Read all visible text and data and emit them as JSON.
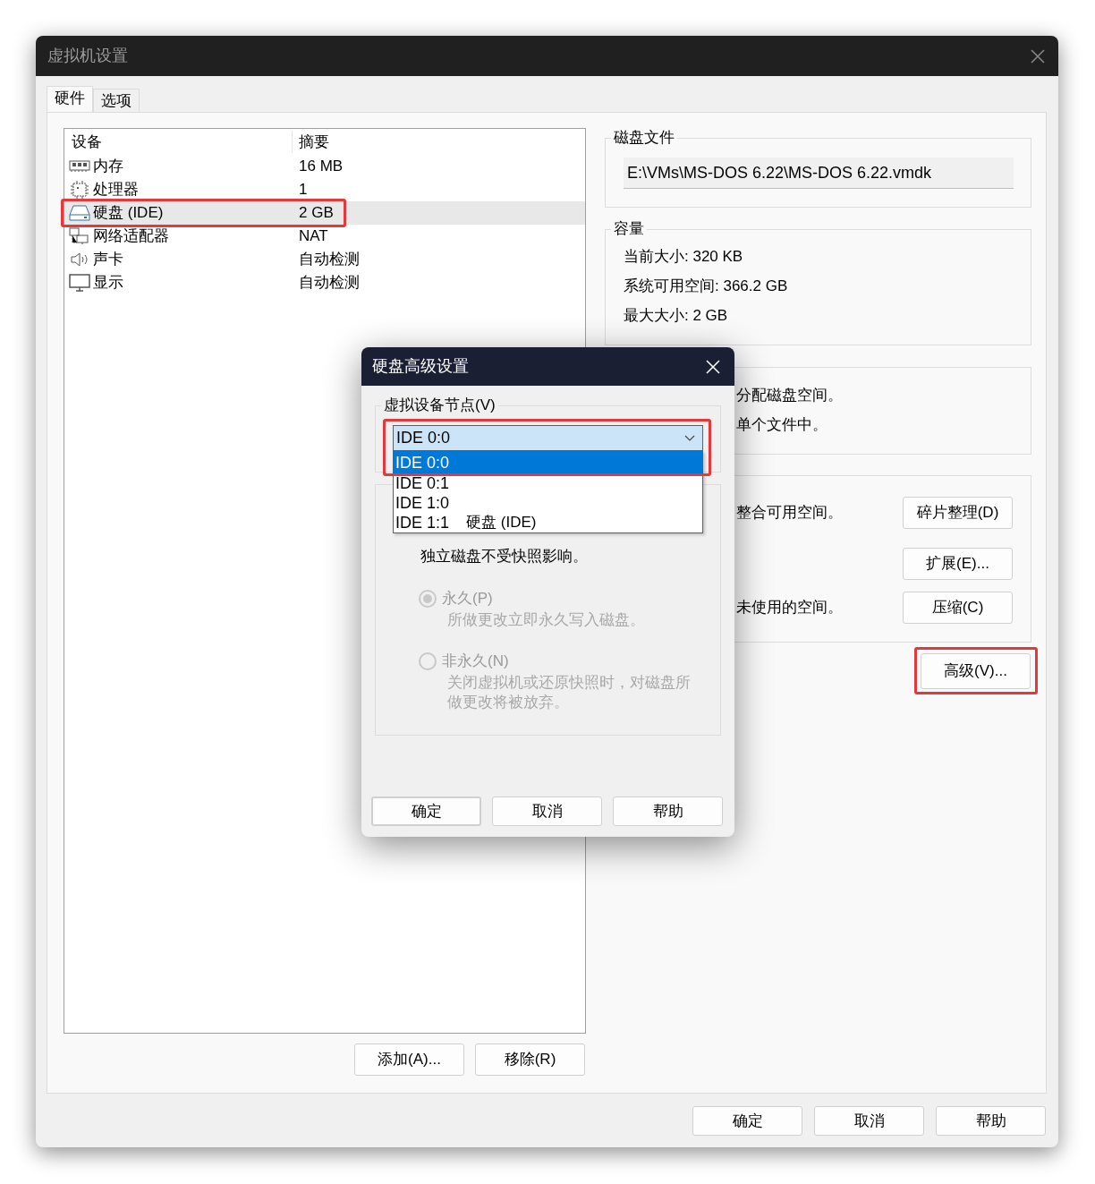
{
  "window": {
    "title": "虚拟机设置"
  },
  "tabs": [
    {
      "label": "硬件",
      "selected": true
    },
    {
      "label": "选项",
      "selected": false
    }
  ],
  "device_list": {
    "columns": [
      "设备",
      "摘要"
    ],
    "rows": [
      {
        "kind": "memory",
        "device": "内存",
        "summary": "16 MB",
        "selected": false,
        "highlighted": false
      },
      {
        "kind": "cpu",
        "device": "处理器",
        "summary": "1",
        "selected": false,
        "highlighted": false
      },
      {
        "kind": "disk",
        "device": "硬盘 (IDE)",
        "summary": "2 GB",
        "selected": true,
        "highlighted": true
      },
      {
        "kind": "network",
        "device": "网络适配器",
        "summary": "NAT",
        "selected": false,
        "highlighted": false
      },
      {
        "kind": "sound",
        "device": "声卡",
        "summary": "自动检测",
        "selected": false,
        "highlighted": false
      },
      {
        "kind": "display",
        "device": "显示",
        "summary": "自动检测",
        "selected": false,
        "highlighted": false
      }
    ]
  },
  "list_buttons": [
    "添加(A)...",
    "移除(R)"
  ],
  "disk_file": {
    "title": "磁盘文件",
    "path": "E:\\VMs\\MS-DOS 6.22\\MS-DOS 6.22.vmdk"
  },
  "capacity": {
    "title": "容量",
    "lines": [
      "当前大小: 320 KB",
      "系统可用空间: 366.2 GB",
      "最大大小: 2 GB"
    ]
  },
  "allocation": {
    "lines": [
      "分配磁盘空间。",
      "单个文件中。"
    ]
  },
  "utilities": [
    {
      "text": "整合可用空间。",
      "button": "碎片整理(D)"
    },
    {
      "button": "扩展(E)..."
    },
    {
      "text": "未使用的空间。",
      "button": "压缩(C)"
    }
  ],
  "advanced_button": {
    "label": "高级(V)...",
    "highlighted": true
  },
  "footer_buttons": [
    "确定",
    "取消",
    "帮助"
  ],
  "dialog": {
    "title": "硬盘高级设置",
    "node_group": {
      "title": "虚拟设备节点(V)",
      "value": "IDE 0:0",
      "highlighted": true,
      "options": [
        {
          "label": "IDE 0:0",
          "selected": true
        },
        {
          "label": "IDE 0:1",
          "selected": false
        },
        {
          "label": "IDE 1:0",
          "selected": false
        },
        {
          "label": "IDE 1:1",
          "note": "硬盘 (IDE)",
          "selected": false
        }
      ]
    },
    "mode_group": {
      "note": "独立磁盘不受快照影响。",
      "options": [
        {
          "label": "永久(P)",
          "description": "所做更改立即永久写入磁盘。",
          "selected": true,
          "disabled": true
        },
        {
          "label": "非永久(N)",
          "description": "关闭虚拟机或还原快照时，对磁盘所做更改将被放弃。",
          "selected": false,
          "disabled": true
        }
      ]
    },
    "buttons": [
      {
        "label": "确定",
        "default": true
      },
      {
        "label": "取消",
        "default": false
      },
      {
        "label": "帮助",
        "default": false
      }
    ]
  }
}
